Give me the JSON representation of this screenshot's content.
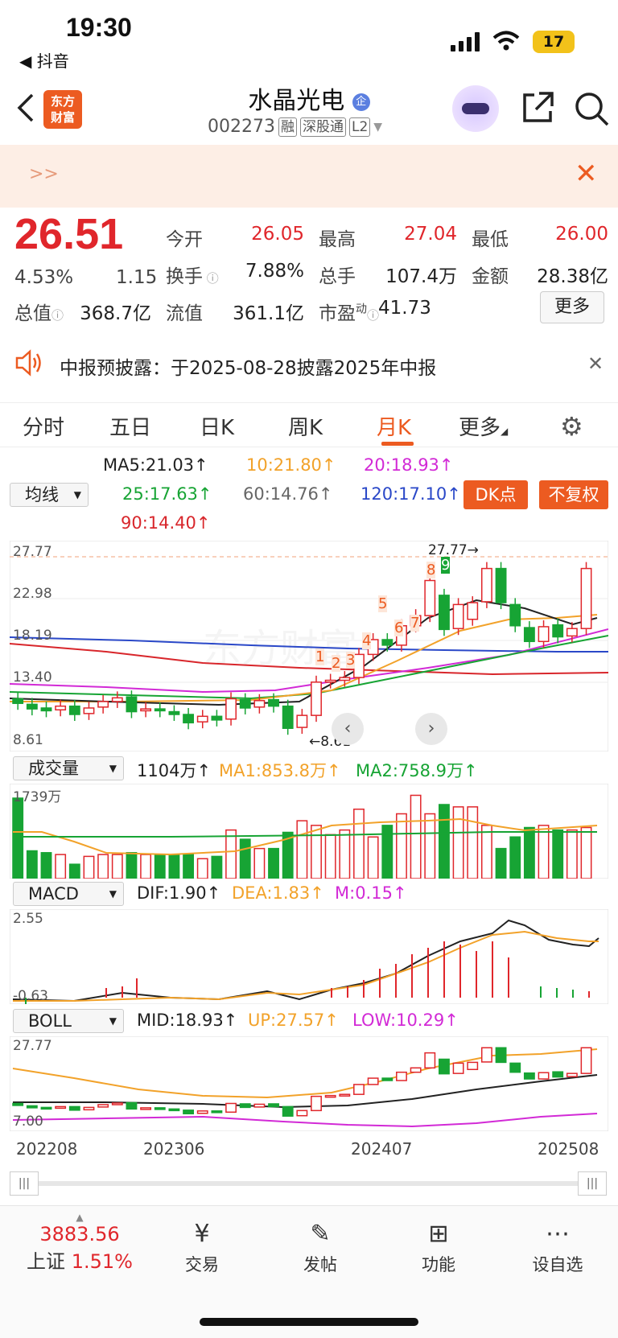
{
  "status_bar": {
    "time": "19:30",
    "back_app": "◀ 抖音",
    "battery": "17"
  },
  "header": {
    "title": "水晶光电",
    "code": "002273",
    "tags": [
      "融",
      "深股通",
      "L2"
    ],
    "logo": "东方\n财富"
  },
  "banner": {
    "text": ">>"
  },
  "quote": {
    "price": "26.51",
    "change_pct": "4.53%",
    "change": "1.15",
    "open_label": "今开",
    "open": "26.05",
    "high_label": "最高",
    "high": "27.04",
    "low_label": "最低",
    "low": "26.00",
    "turnover_label": "换手",
    "turnover": "7.88%",
    "volume_label": "总手",
    "volume": "107.4万",
    "amount_label": "金额",
    "amount": "28.38亿",
    "mktcap_label": "总值",
    "mktcap": "368.7亿",
    "float_label": "流值",
    "float": "361.1亿",
    "pe_label": "市盈",
    "pe_sup": "动",
    "pe": "41.73",
    "more": "更多"
  },
  "notice": {
    "text": "中报预披露：于2025-08-28披露2025年中报"
  },
  "tabs": [
    "分时",
    "五日",
    "日K",
    "周K",
    "月K",
    "更多"
  ],
  "active_tab": "月K",
  "ma": {
    "selector": "均线",
    "ma5": "MA5:21.03↑",
    "ma10": "10:21.80↑",
    "ma20": "20:18.93↑",
    "ma25": "25:17.63↑",
    "ma60": "60:14.76↑",
    "ma120": "120:17.10↑",
    "ma90": "90:14.40↑",
    "dk": "DK点",
    "fq": "不复权"
  },
  "kline": {
    "y_labels": [
      "27.77",
      "22.98",
      "18.19",
      "13.40",
      "8.61"
    ],
    "high_mark": "27.77→",
    "low_mark": "←8.61",
    "counts": [
      "1",
      "2",
      "3",
      "4",
      "5",
      "6",
      "7",
      "8",
      "9"
    ]
  },
  "volume": {
    "selector": "成交量",
    "value": "1104万↑",
    "ma1": "MA1:853.8万↑",
    "ma2": "MA2:758.9万↑",
    "y_top": "1739万"
  },
  "macd": {
    "selector": "MACD",
    "dif": "DIF:1.90↑",
    "dea": "DEA:1.83↑",
    "m": "M:0.15↑",
    "y_top": "2.55",
    "y_bottom": "-0.63"
  },
  "boll": {
    "selector": "BOLL",
    "mid": "MID:18.93↑",
    "up": "UP:27.57↑",
    "low": "LOW:10.29↑",
    "y_top": "27.77",
    "y_bottom": "7.00"
  },
  "x_labels": [
    "202208",
    "202306",
    "202407",
    "202508"
  ],
  "bottom_nav": {
    "index_value": "3883.56",
    "index_name": "上证",
    "index_pct": "1.51%",
    "items": [
      "交易",
      "发帖",
      "功能",
      "设自选"
    ]
  },
  "chart_data": {
    "type": "candlestick",
    "candles": [
      {
        "o": 12.4,
        "c": 11.9
      },
      {
        "o": 11.8,
        "c": 11.3
      },
      {
        "o": 11.4,
        "c": 11.1
      },
      {
        "o": 11.2,
        "c": 11.6
      },
      {
        "o": 11.6,
        "c": 10.7
      },
      {
        "o": 10.8,
        "c": 11.4
      },
      {
        "o": 11.5,
        "c": 12.1
      },
      {
        "o": 12.1,
        "c": 12.5
      },
      {
        "o": 12.6,
        "c": 11.0
      },
      {
        "o": 11.1,
        "c": 11.3
      },
      {
        "o": 11.3,
        "c": 11.1
      },
      {
        "o": 11.0,
        "c": 10.7
      },
      {
        "o": 10.7,
        "c": 9.8
      },
      {
        "o": 9.9,
        "c": 10.5
      },
      {
        "o": 10.5,
        "c": 10.1
      },
      {
        "o": 10.2,
        "c": 12.4
      },
      {
        "o": 12.3,
        "c": 11.4
      },
      {
        "o": 11.5,
        "c": 12.2
      },
      {
        "o": 12.3,
        "c": 11.6
      },
      {
        "o": 11.6,
        "c": 9.2
      },
      {
        "o": 9.3,
        "c": 10.6
      },
      {
        "o": 10.6,
        "c": 14.2
      },
      {
        "o": 14.2,
        "c": 14.4
      },
      {
        "o": 14.4,
        "c": 14.7
      },
      {
        "o": 14.7,
        "c": 17.2
      },
      {
        "o": 17.2,
        "c": 18.8
      },
      {
        "o": 18.8,
        "c": 18.2
      },
      {
        "o": 18.2,
        "c": 20.3
      },
      {
        "o": 20.3,
        "c": 21.4
      },
      {
        "o": 21.4,
        "c": 25.2
      },
      {
        "o": 23.6,
        "c": 19.9
      },
      {
        "o": 20.0,
        "c": 22.6
      },
      {
        "o": 21.0,
        "c": 22.8
      },
      {
        "o": 22.9,
        "c": 26.5
      },
      {
        "o": 26.5,
        "c": 22.8
      },
      {
        "o": 22.6,
        "c": 20.3
      },
      {
        "o": 20.1,
        "c": 18.6
      },
      {
        "o": 18.6,
        "c": 20.2
      },
      {
        "o": 20.4,
        "c": 19.1
      },
      {
        "o": 19.2,
        "c": 20.0
      },
      {
        "o": 20.0,
        "c": 26.5
      }
    ],
    "volumes": [
      1739,
      600,
      560,
      520,
      310,
      480,
      520,
      520,
      560,
      520,
      520,
      520,
      520,
      430,
      480,
      1050,
      850,
      650,
      650,
      1000,
      1250,
      1150,
      950,
      1050,
      1500,
      900,
      1150,
      1400,
      1800,
      1400,
      1600,
      1550,
      1550,
      1150,
      650,
      900,
      1104,
      1150,
      1050,
      1050,
      1104
    ]
  }
}
